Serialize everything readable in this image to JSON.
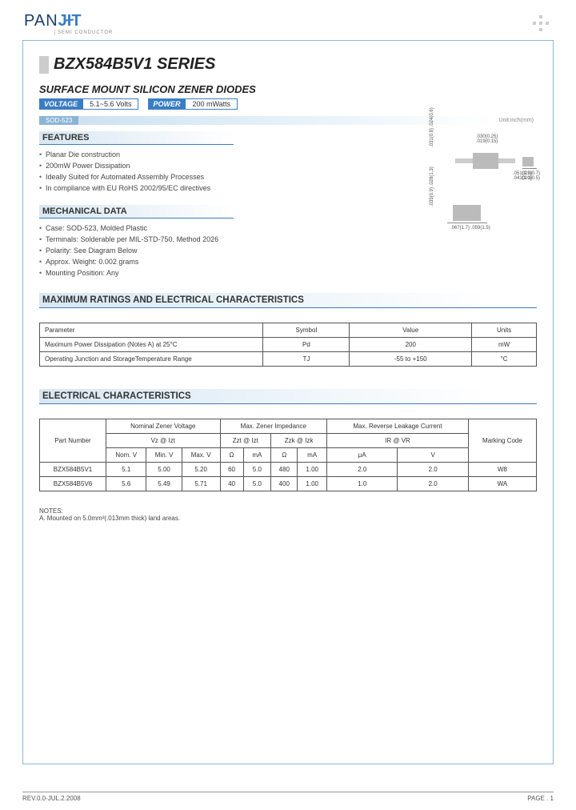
{
  "logo": {
    "part1": "PAN",
    "part2": "JIT",
    "sub": "SEMI\nCONDUCTOR"
  },
  "title": "BZX584B5V1 SERIES",
  "subtitle": "SURFACE MOUNT SILICON ZENER DIODES",
  "voltage_label": "VOLTAGE",
  "voltage_value": "5.1~5.6 Volts",
  "power_label": "POWER",
  "power_value": "200 mWatts",
  "sod_label": "SOD-523",
  "unit_label": "Unit:inch(mm)",
  "features_hdr": "FEATURES",
  "features": [
    "Planar Die construction",
    "200mW Power Dissipation",
    "Ideally Suited for Automated Assembly Processes",
    "In compliance with EU RoHS 2002/95/EC directives"
  ],
  "mech_hdr": "MECHANICAL DATA",
  "mech": [
    "Case: SOD-523, Molded Plastic",
    "Terminals: Solderable per MIL-STD-750, Method 2026",
    "Polarity: See Diagram Below",
    "Approx. Weight: 0.002 grams",
    "Mounting Position: Any"
  ],
  "diag_dims": {
    "top1": ".030(0.25)\n.019(0.15)",
    "top2": ".031(0.8)\n.024(0.6)",
    "top3": ".051(1.3)\n.043(1.1)",
    "side": ".028(0.7)\n.020(0.5)",
    "bot1": ".067(1.7)\n.059(1.5)",
    "bot2": ".035(0.9)\n.028(1.3)"
  },
  "max_hdr": "MAXIMUM RATINGS AND ELECTRICAL CHARACTERISTICS",
  "max_table": {
    "headers": [
      "Parameter",
      "Symbol",
      "Value",
      "Units"
    ],
    "rows": [
      [
        "Maximum Power Dissipation (Notes A) at 25°C",
        "Pd",
        "200",
        "mW"
      ],
      [
        "Operating Junction and StorageTemperature Range",
        "TJ",
        "-55 to +150",
        "°C"
      ]
    ]
  },
  "elec_hdr": "ELECTRICAL CHARACTERISTICS",
  "elec_table": {
    "h1": [
      "Part Number",
      "Nominal Zener Voltage",
      "Max. Zener Impedance",
      "Max. Reverse Leakage Current",
      "Marking Code"
    ],
    "h2": [
      "Vz @ Izt",
      "Zzt @ Izt",
      "Zzk @ Izk",
      "IR @ VR"
    ],
    "h3": [
      "Nom. V",
      "Min. V",
      "Max. V",
      "Ω",
      "mA",
      "Ω",
      "mA",
      "μA",
      "V"
    ],
    "rows": [
      [
        "BZX584B5V1",
        "5.1",
        "5.00",
        "5.20",
        "60",
        "5.0",
        "480",
        "1.00",
        "2.0",
        "2.0",
        "W8"
      ],
      [
        "BZX584B5V6",
        "5.6",
        "5.49",
        "5.71",
        "40",
        "5.0",
        "400",
        "1.00",
        "1.0",
        "2.0",
        "WA"
      ]
    ]
  },
  "notes_hdr": "NOTES:",
  "notes": "A. Mounted on 5.0mm²(.013mm thick) land areas.",
  "footer_left": "REV.0.0-JUL.2.2008",
  "footer_right": "PAGE .  1"
}
